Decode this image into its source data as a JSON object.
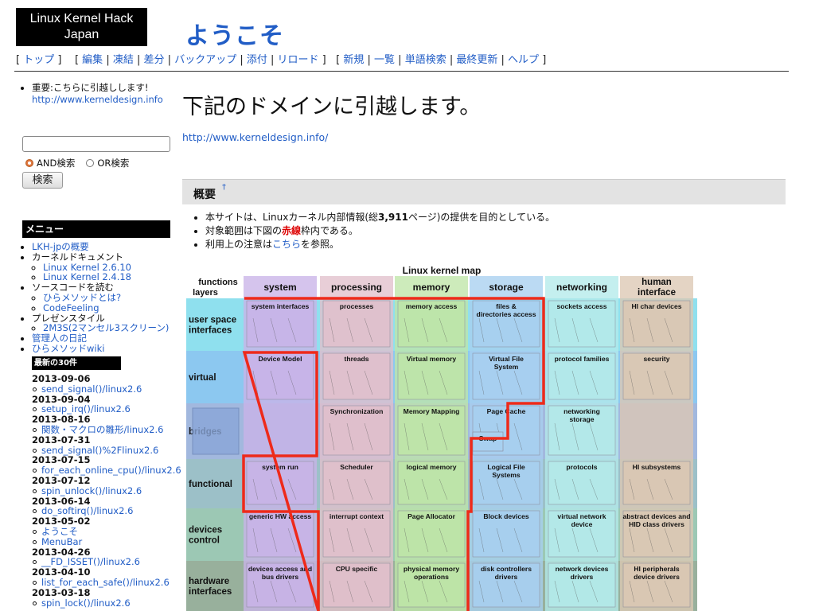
{
  "logo": {
    "line1": "Linux Kernel Hack",
    "line2": "Japan"
  },
  "page_title": "ようこそ",
  "nav": {
    "top": "トップ",
    "edit": "編集",
    "freeze": "凍結",
    "diff": "差分",
    "backup": "バックアップ",
    "attach": "添付",
    "reload": "リロード",
    "new": "新規",
    "list": "一覧",
    "search": "単語検索",
    "recent": "最終更新",
    "help": "ヘルプ"
  },
  "notice": {
    "text": "重要:こちらに引越しします!",
    "link": "http://www.kerneldesign.info"
  },
  "search": {
    "and": "AND検索",
    "or": "OR検索",
    "button": "検索",
    "value": ""
  },
  "menu": {
    "header": "メニュー",
    "overview": "LKH-jpの概要",
    "kdoc": "カーネルドキュメント",
    "k2610": "Linux Kernel 2.6.10",
    "k2418": "Linux Kernel 2.4.18",
    "readsrc": "ソースコードを読む",
    "hira": "ひらメソッドとは?",
    "cf": "CodeFeeling",
    "pres": "プレゼンスタイル",
    "m3s": "2M3S(2マンセル3スクリーン)",
    "diary": "管理人の日記",
    "wiki": "ひらメソッドwiki"
  },
  "recent": {
    "header": "最新の30件",
    "entries": [
      {
        "date": "2013-09-06",
        "items": [
          "send_signal()/linux2.6"
        ]
      },
      {
        "date": "2013-09-04",
        "items": [
          "setup_irq()/linux2.6"
        ]
      },
      {
        "date": "2013-08-16",
        "items": [
          "関数・マクロの雛形/linux2.6"
        ]
      },
      {
        "date": "2013-07-31",
        "items": [
          "send_signal()%2Flinux2.6"
        ]
      },
      {
        "date": "2013-07-15",
        "items": [
          "for_each_online_cpu()/linux2.6"
        ]
      },
      {
        "date": "2013-07-12",
        "items": [
          "spin_unlock()/linux2.6"
        ]
      },
      {
        "date": "2013-06-14",
        "items": [
          "do_softirq()/linux2.6"
        ]
      },
      {
        "date": "2013-05-02",
        "items": [
          "ようこそ",
          "MenuBar"
        ]
      },
      {
        "date": "2013-04-26",
        "items": [
          "__FD_ISSET()/linux2.6"
        ]
      },
      {
        "date": "2013-04-10",
        "items": [
          "list_for_each_safe()/linux2.6"
        ]
      },
      {
        "date": "2013-03-18",
        "items": [
          "spin_lock()/linux2.6"
        ]
      }
    ]
  },
  "main": {
    "heading": "下記のドメインに引越します。",
    "link": "http://www.kerneldesign.info/",
    "overview": "概要",
    "anchor": "†",
    "intro1_a": "本サイトは、Linuxカーネル内部情報(総",
    "intro1_b": "3,911",
    "intro1_c": "ページ)の提供を目的としている。",
    "intro2_a": "対象範囲は下図の",
    "intro2_b": "赤線",
    "intro2_c": "枠内である。",
    "intro3_a": "利用上の注意は",
    "intro3_b": "こちら",
    "intro3_c": "を参照。"
  },
  "kernel_map": {
    "title": "Linux kernel map",
    "corner": [
      "functions",
      "layers"
    ],
    "columns": [
      "system",
      "processing",
      "memory",
      "storage",
      "networking",
      "human interface"
    ],
    "rows": [
      "user space interfaces",
      "virtual",
      "bridges",
      "functional",
      "devices control",
      "hardware interfaces"
    ],
    "boxes": {
      "si": "system interfaces",
      "proc": "processes",
      "ma": "memory access",
      "fda": "files & directories access",
      "sa": "sockets access",
      "hic": "HI char devices",
      "dm": "Device Model",
      "thr": "threads",
      "vm": "Virtual memory",
      "vfs": "Virtual File System",
      "pf": "protocol families",
      "sec": "security",
      "sync": "Synchronization",
      "mm": "Memory Mapping",
      "pc": "Page Cache",
      "swap": "Swap",
      "ns": "networking storage",
      "sr": "system run",
      "sched": "Scheduler",
      "lm": "logical memory",
      "lfs": "Logical File Systems",
      "protos": "protocols",
      "his": "HI subsystems",
      "gha": "generic HW access",
      "ic": "interrupt context",
      "pa": "Page Allocator",
      "bd": "Block devices",
      "vnd": "virtual network device",
      "ahid": "abstract devices and HID class drivers",
      "daab": "devices access and bus drivers",
      "cpu": "CPU specific",
      "pmo": "physical memory operations",
      "dcd": "disk controllers drivers",
      "nd": "network devices drivers",
      "hip": "HI peripherals device drivers"
    },
    "colors": {
      "system": "#c9b4e8",
      "processing": "#e2c0cc",
      "memory": "#bfe6a8",
      "storage": "#a8d0f0",
      "networking": "#b4eaea",
      "human": "#dcc8b4",
      "frame": "#ee2a1a"
    }
  }
}
